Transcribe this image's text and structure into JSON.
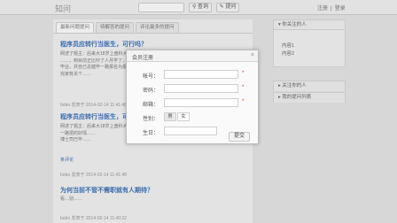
{
  "header": {
    "logo": "知问",
    "search_label": "查询",
    "ask_label": "提问",
    "links": [
      "注册",
      "|",
      "登录"
    ]
  },
  "main": {
    "tabs": [
      "最新问题提问",
      "待解答的提问",
      "评论最多的提问"
    ],
    "questions": [
      {
        "title": "程序员应转行当医生，可行吗？",
        "body": [
          "网述了题主：后来大18岁上盘科大学",
          "……，到目前正比吵了人月学了，再做",
          "毕业，并自己总健毕一路报名为报……",
          "完家有关个……"
        ],
        "meta": "bobo 发表于 2014-02-14 11:41:48"
      },
      {
        "title": "程序员应转行当医生，可行吗？",
        "body": [
          "网述了题主：后来大18岁上盘科大学，……",
          "一路把的好情……",
          "博士司已毕……"
        ],
        "meta": "bobo 发表于 2014-02-14 11:41:48",
        "comments": "条评论"
      },
      {
        "title": "为何当前不管不需职就有人期待？",
        "body": [
          "看…别……"
        ],
        "meta": "bobo 发表于 2014-02-14 11:40:22"
      }
    ]
  },
  "sidebar": {
    "box1_title": "你关注的人",
    "box1_items": [
      "内容1",
      "内容2"
    ],
    "box2_title": "关注你的人",
    "box3_title": "我的提问列表"
  },
  "modal": {
    "title": "会员注册",
    "close": "×",
    "fields": {
      "account": "帐号：",
      "password": "密码：",
      "email": "邮箱：",
      "gender": "性别：",
      "birthday": "生日："
    },
    "required_mark": "*",
    "gender_options": [
      "男",
      "女"
    ],
    "submit": "提交"
  }
}
